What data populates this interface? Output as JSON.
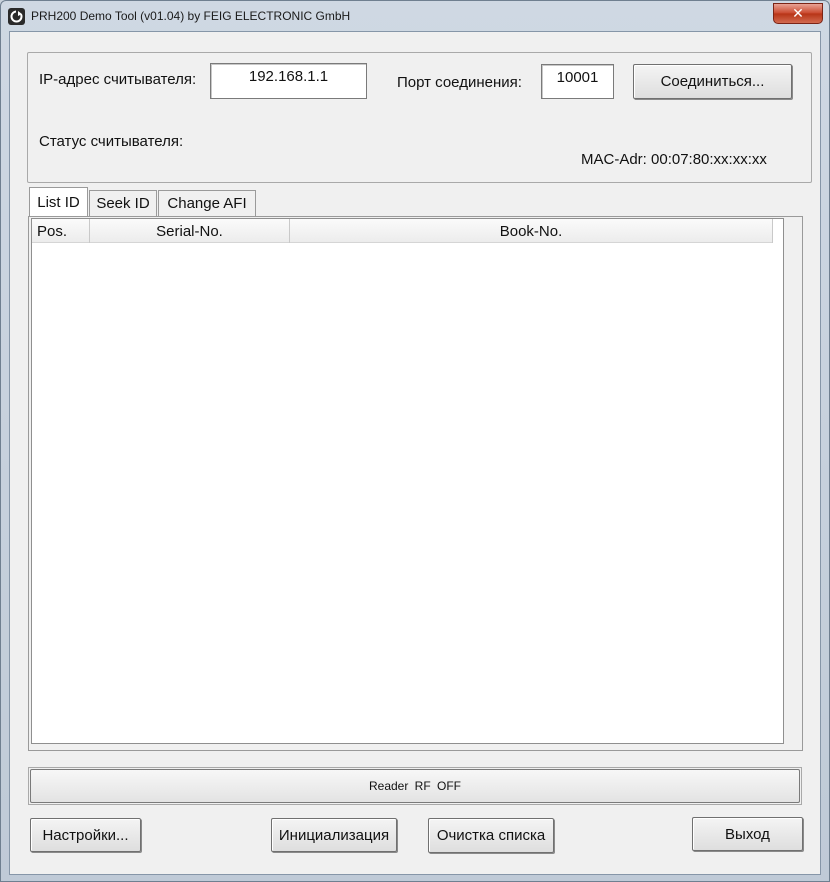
{
  "window": {
    "title": "PRH200 Demo Tool (v01.04) by FEIG ELECTRONIC GmbH",
    "close_label": "✕"
  },
  "connection": {
    "ip_label": "IP-адрес считывателя:",
    "ip_value": "192.168.1.1",
    "port_label": "Порт соединения:",
    "port_value": "10001",
    "connect_button": "Соединиться...",
    "status_label": "Статус считывателя:",
    "mac": "MAC-Adr: 00:07:80:xx:xx:xx"
  },
  "tabs": [
    {
      "label": "List ID",
      "active": true
    },
    {
      "label": "Seek ID",
      "active": false
    },
    {
      "label": "Change AFI",
      "active": false
    }
  ],
  "list": {
    "columns": [
      "Pos.",
      "Serial-No.",
      "Book-No."
    ],
    "rows": []
  },
  "status_bar": {
    "rf_status": "Reader RF OFF"
  },
  "buttons": {
    "settings": "Настройки...",
    "init": "Инициализация",
    "clear": "Очистка списка",
    "exit": "Выход"
  }
}
